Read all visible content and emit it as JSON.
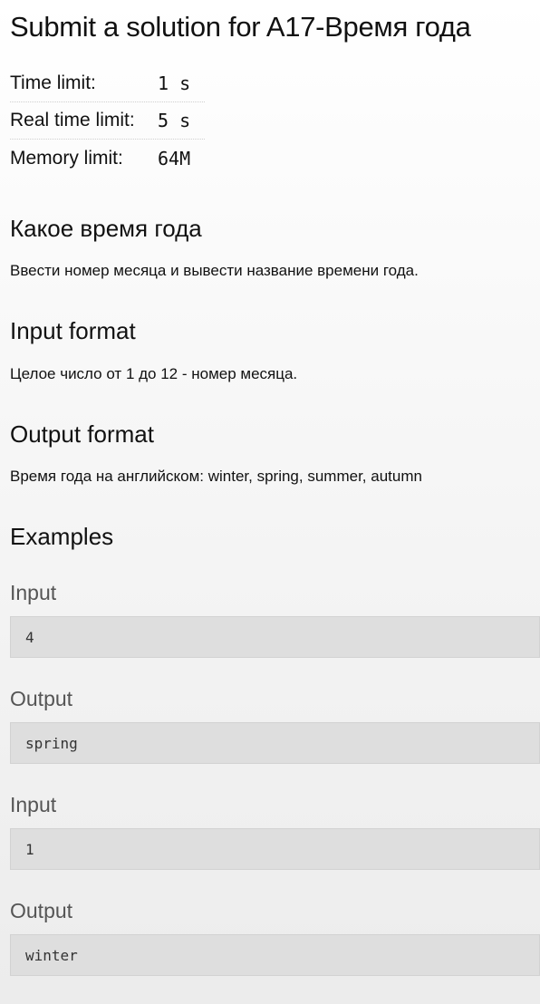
{
  "title": "Submit a solution for A17-Время года",
  "limits": [
    {
      "label": "Time limit:",
      "value": "1 s"
    },
    {
      "label": "Real time limit:",
      "value": "5 s"
    },
    {
      "label": "Memory limit:",
      "value": "64M"
    }
  ],
  "statement": {
    "heading": "Какое время года",
    "text": "Ввести номер месяца и вывести название времени года."
  },
  "input_format": {
    "heading": "Input format",
    "text": "Целое число от 1 до 12 - номер месяца."
  },
  "output_format": {
    "heading": "Output format",
    "text": "Время года на английском: winter, spring, summer, autumn"
  },
  "examples": {
    "heading": "Examples",
    "items": [
      {
        "input_label": "Input",
        "input": "4",
        "output_label": "Output",
        "output": "spring"
      },
      {
        "input_label": "Input",
        "input": "1",
        "output_label": "Output",
        "output": "winter"
      }
    ]
  }
}
